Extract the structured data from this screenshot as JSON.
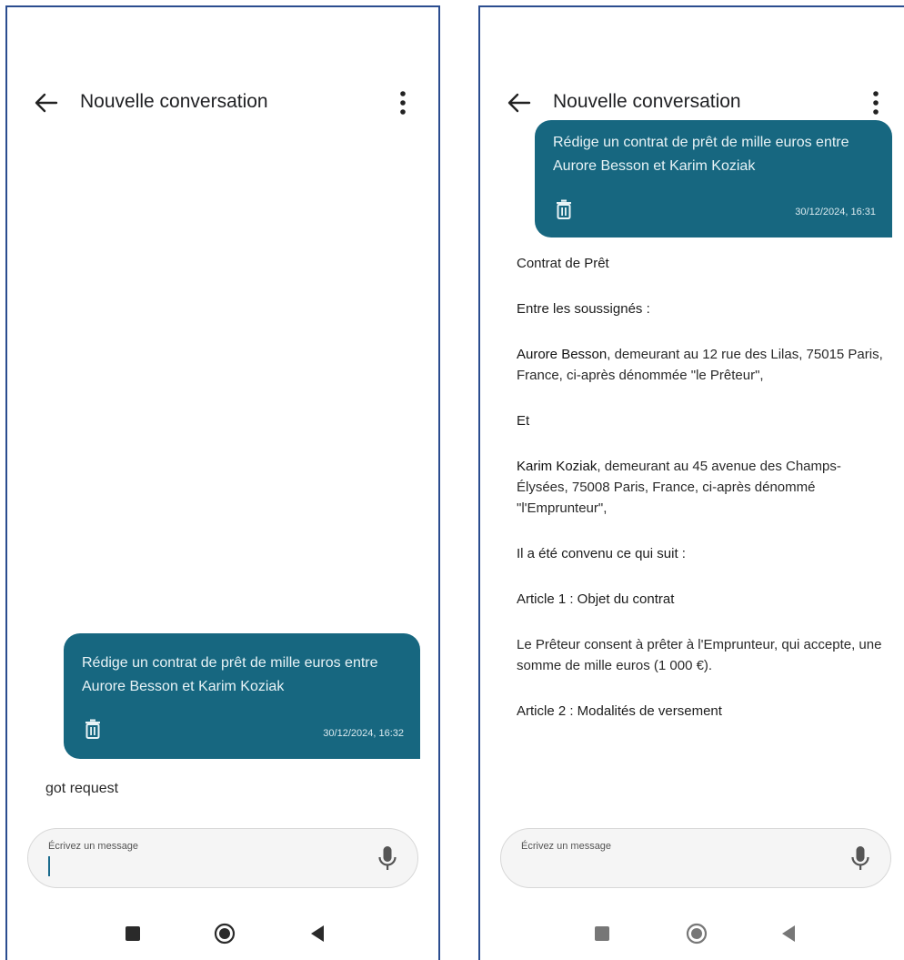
{
  "left": {
    "header": {
      "title": "Nouvelle conversation"
    },
    "message": {
      "text": "Rédige un contrat de prêt de mille euros entre Aurore Besson et Karim Koziak",
      "timestamp": "30/12/2024, 16:32"
    },
    "reply": "got request",
    "composer": {
      "placeholder": "Écrivez un message"
    }
  },
  "right": {
    "header": {
      "title": "Nouvelle conversation"
    },
    "message": {
      "text": "Rédige un contrat de prêt de mille euros entre Aurore Besson et Karim Koziak",
      "timestamp": "30/12/2024, 16:31"
    },
    "document": {
      "title": "Contrat de Prêt",
      "parties_heading": "Entre les soussignés :",
      "party1_name": "Aurore Besson",
      "party1_rest": ", demeurant au 12 rue des Lilas, 75015 Paris, France, ci-après dénommée \"le Prêteur\",",
      "and": "Et",
      "party2_name": "Karim Koziak",
      "party2_rest": ", demeurant au 45 avenue des Champs-Élysées, 75008 Paris, France, ci-après dénommé \"l'Emprunteur\",",
      "agreed": "Il a été convenu ce qui suit :",
      "article1_title": "Article 1 : Objet du contrat",
      "article1_body": "Le Prêteur consent à prêter à l'Emprunteur, qui accepte, une somme de mille euros (1 000 €).",
      "article2_title": "Article 2 : Modalités de versement"
    },
    "composer": {
      "placeholder": "Écrivez un message"
    }
  },
  "colors": {
    "bubble": "#176780",
    "frame": "#2b4d8f"
  },
  "icons": [
    "back-arrow-icon",
    "more-vert-icon",
    "trash-icon",
    "microphone-icon",
    "nav-recents-icon",
    "nav-home-icon",
    "nav-back-icon"
  ]
}
